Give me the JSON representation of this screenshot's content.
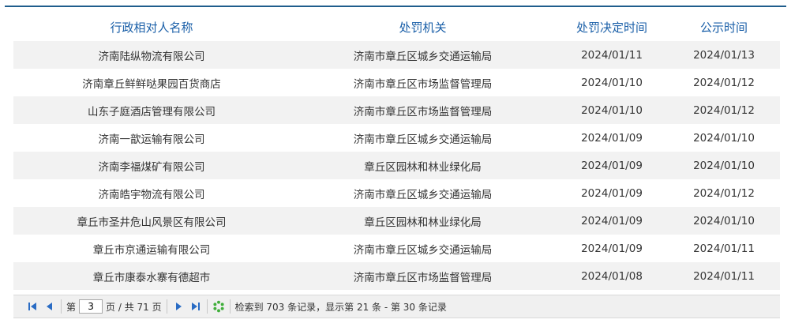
{
  "table": {
    "headers": [
      "行政相对人名称",
      "处罚机关",
      "处罚决定时间",
      "公示时间"
    ],
    "rows": [
      [
        "济南陆纵物流有限公司",
        "济南市章丘区城乡交通运输局",
        "2024/01/11",
        "2024/01/13"
      ],
      [
        "济南章丘鲜鲜哒果园百货商店",
        "济南市章丘区市场监督管理局",
        "2024/01/10",
        "2024/01/12"
      ],
      [
        "山东子庭酒店管理有限公司",
        "济南市章丘区市场监督管理局",
        "2024/01/10",
        "2024/01/12"
      ],
      [
        "济南一歆运输有限公司",
        "济南市章丘区城乡交通运输局",
        "2024/01/09",
        "2024/01/10"
      ],
      [
        "济南李福煤矿有限公司",
        "章丘区园林和林业绿化局",
        "2024/01/09",
        "2024/01/10"
      ],
      [
        "济南皓宇物流有限公司",
        "济南市章丘区城乡交通运输局",
        "2024/01/09",
        "2024/01/12"
      ],
      [
        "章丘市圣井危山风景区有限公司",
        "章丘区园林和林业绿化局",
        "2024/01/09",
        "2024/01/10"
      ],
      [
        "章丘市京通运输有限公司",
        "济南市章丘区城乡交通运输局",
        "2024/01/09",
        "2024/01/11"
      ],
      [
        "章丘市康泰水寨有德超市",
        "济南市章丘区市场监督管理局",
        "2024/01/08",
        "2024/01/11"
      ]
    ]
  },
  "pager": {
    "page_prefix": "第",
    "current_page": "3",
    "page_suffix": "页 / 共 71 页",
    "summary": "检索到 703 条记录，显示第 21 条 - 第 30 条记录"
  },
  "colors": {
    "header_text": "#1a5fa8",
    "top_line": "#1f5d8c",
    "row_alt": "#f2f2f2",
    "pager_icon": "#2a6cc4",
    "refresh_icon": "#3fae3a"
  }
}
